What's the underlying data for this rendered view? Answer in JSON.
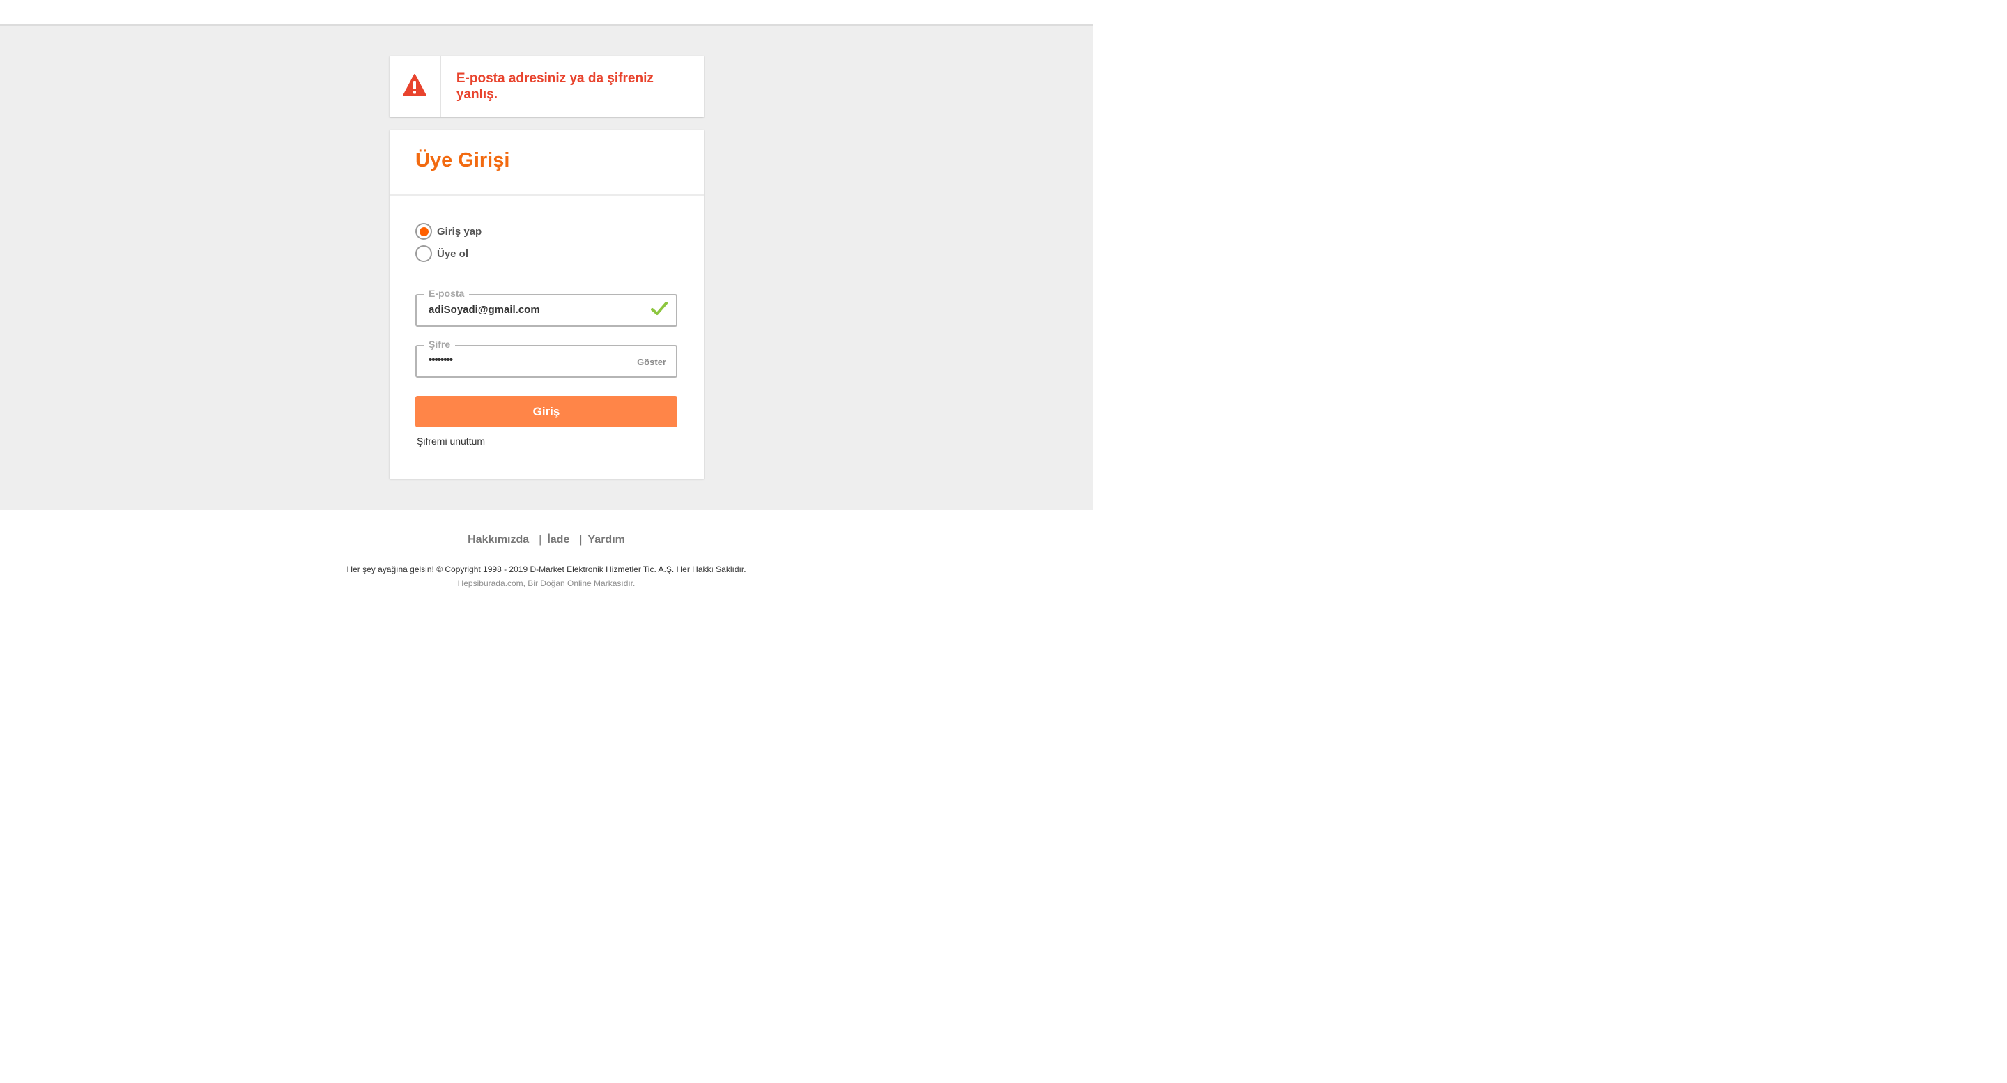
{
  "alert": {
    "icon": "warning-triangle-icon",
    "message": "E-posta adresiniz ya da şifreniz yanlış.",
    "color": "#e8432d"
  },
  "login": {
    "title": "Üye Girişi",
    "title_color": "#f26a10",
    "radio_options": [
      {
        "label": "Giriş yap",
        "selected": true
      },
      {
        "label": "Üye ol",
        "selected": false
      }
    ],
    "email": {
      "legend": "E-posta",
      "value": "adiSoyadi@gmail.com",
      "valid_icon": "checkmark-icon"
    },
    "password": {
      "legend": "Şifre",
      "value": "••••••••",
      "show_label": "Göster"
    },
    "submit_label": "Giriş",
    "submit_color": "#ff8548",
    "forgot_label": "Şifremi unuttum"
  },
  "footer": {
    "links": [
      "Hakkımızda",
      "İade",
      "Yardım"
    ],
    "separator": "|",
    "copyright": "Her şey ayağına gelsin! © Copyright 1998 - 2019 D-Market Elektronik Hizmetler Tic. A.Ş. Her Hakkı Saklıdır.",
    "brand": "Hepsiburada.com, Bir Doğan Online Markasıdır."
  }
}
